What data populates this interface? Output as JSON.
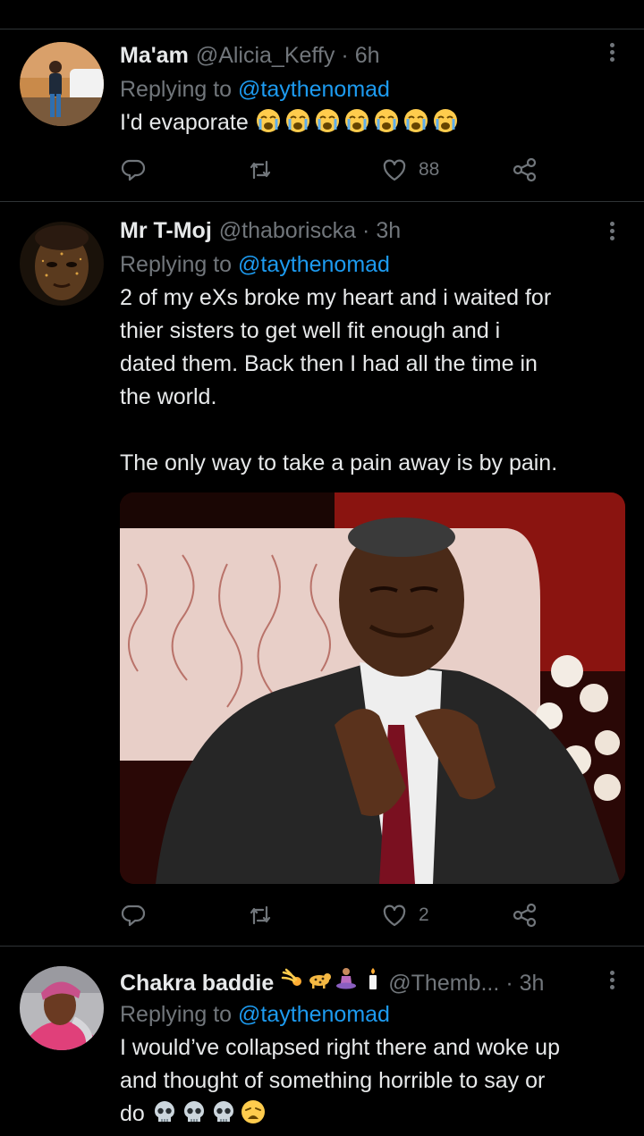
{
  "colors": {
    "background": "#000000",
    "text_primary": "#e7e9ea",
    "text_secondary": "#71767b",
    "accent": "#1d9bf0",
    "divider": "#2f3336"
  },
  "tweets": [
    {
      "name": "Ma'am",
      "handle": "@Alicia_Keffy",
      "separator": "·",
      "time": "6h",
      "replying_prefix": "Replying to ",
      "replying_to": "@taythenomad",
      "text": "I'd evaporate",
      "text_emojis": [
        "loudly-crying-face",
        "loudly-crying-face",
        "loudly-crying-face",
        "loudly-crying-face",
        "loudly-crying-face",
        "loudly-crying-face",
        "loudly-crying-face"
      ],
      "likes": "88",
      "icons": [
        "reply-icon",
        "retweet-icon",
        "like-icon",
        "share-icon",
        "more-icon"
      ]
    },
    {
      "name": "Mr T-Moj",
      "handle": "@thaboriscka",
      "separator": "·",
      "time": "3h",
      "replying_prefix": "Replying to ",
      "replying_to": "@taythenomad",
      "text": "2 of my eXs broke my heart and i waited for\nthier sisters to get well fit enough and i\ndated them. Back then I had all the time in\nthe world.\n\nThe only way to take a pain away is by pain.",
      "likes": "2",
      "icons": [
        "reply-icon",
        "retweet-icon",
        "like-icon",
        "share-icon",
        "more-icon"
      ]
    },
    {
      "name": "Chakra baddie",
      "name_emojis": [
        "comet",
        "leopard",
        "person-in-lotus-position",
        "candle"
      ],
      "handle": "@Themb...",
      "separator": "·",
      "time": "3h",
      "replying_prefix": "Replying to ",
      "replying_to": "@taythenomad",
      "text": "I would’ve collapsed right there and woke up\nand thought of something horrible to say or\ndo",
      "text_emojis": [
        "skull",
        "skull",
        "skull",
        "weary-face"
      ],
      "icons": [
        "more-icon"
      ]
    }
  ]
}
